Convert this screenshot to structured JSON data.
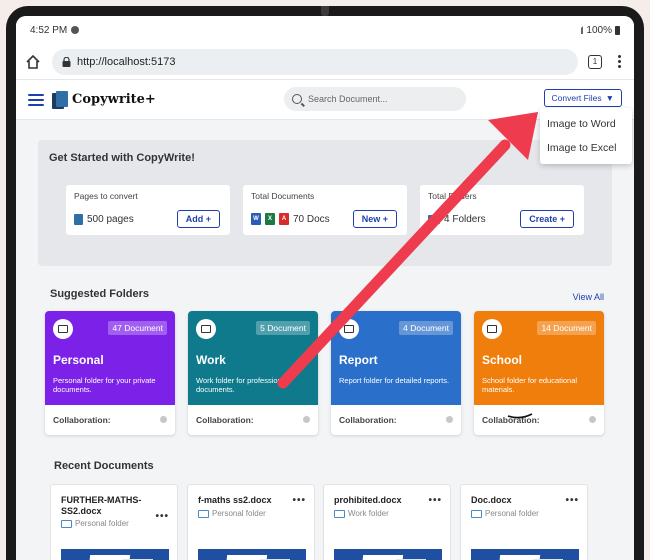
{
  "status_bar": {
    "time": "4:52 PM",
    "battery": "100%"
  },
  "browser": {
    "url": "http://localhost:5173",
    "tab_count": "1"
  },
  "header": {
    "app_name": "Copywrite+",
    "search_placeholder": "Search Document...",
    "convert_label": "Convert Files",
    "convert_caret": "▼"
  },
  "convert_menu": {
    "items": [
      "Image to Word",
      "Image to Excel"
    ]
  },
  "get_started": {
    "title": "Get Started with CopyWrite!",
    "cards": [
      {
        "label": "Pages to convert",
        "value": "500 pages",
        "button": "Add +"
      },
      {
        "label": "Total Documents",
        "value": "70 Docs",
        "button": "New +"
      },
      {
        "label": "Total Folders",
        "value": "4 Folders",
        "button": "Create +"
      }
    ]
  },
  "suggested": {
    "title": "Suggested Folders",
    "view_all": "View All",
    "folders": [
      {
        "name": "Personal",
        "count": "47 Document",
        "desc": "Personal folder for your private documents.",
        "collab": "Collaboration:",
        "color": "#7c22e8"
      },
      {
        "name": "Work",
        "count": "5 Document",
        "desc": "Work folder for professional documents.",
        "collab": "Collaboration:",
        "color": "#0e7a8c"
      },
      {
        "name": "Report",
        "count": "4 Document",
        "desc": "Report folder for detailed reports.",
        "collab": "Collaboration:",
        "color": "#2a6fc9"
      },
      {
        "name": "School",
        "count": "14 Document",
        "desc": "School folder for educational materials.",
        "collab": "Collaboration:",
        "color": "#f07e0c"
      }
    ]
  },
  "recent": {
    "title": "Recent Documents",
    "docs": [
      {
        "name": "FURTHER-MATHS-SS2.docx",
        "folder": "Personal folder"
      },
      {
        "name": "f-maths ss2.docx",
        "folder": "Personal folder"
      },
      {
        "name": "prohibited.docx",
        "folder": "Work folder"
      },
      {
        "name": "Doc.docx",
        "folder": "Personal folder"
      }
    ],
    "more": "•••"
  },
  "file_type_icons": [
    "word",
    "excel",
    "pdf"
  ],
  "colors": {
    "accent": "#1e40af",
    "arrow": "#ef3b4e"
  }
}
